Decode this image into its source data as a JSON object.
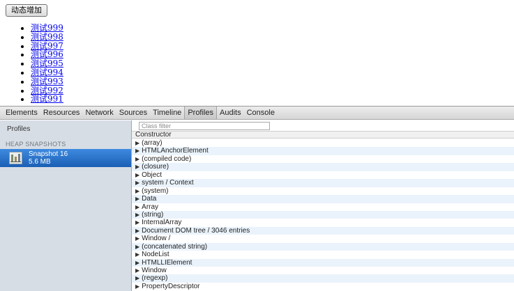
{
  "page": {
    "button_label": "动态增加",
    "links": [
      "测试999",
      "测试998",
      "测试997",
      "测试996",
      "测试995",
      "测试994",
      "测试993",
      "测试992",
      "测试991"
    ]
  },
  "devtools": {
    "tabs": [
      "Elements",
      "Resources",
      "Network",
      "Sources",
      "Timeline",
      "Profiles",
      "Audits",
      "Console"
    ],
    "active_tab": "Profiles",
    "sidebar": {
      "title": "Profiles",
      "section": "HEAP SNAPSHOTS",
      "snapshot_name": "Snapshot 16",
      "snapshot_size": "5.6 MB"
    },
    "filter_placeholder": "Class filter",
    "column_header": "Constructor",
    "constructors": [
      "(array)",
      "HTMLAnchorElement",
      "(compiled code)",
      "(closure)",
      "Object",
      "system / Context",
      "(system)",
      "Data",
      "Array",
      "(string)",
      "InternalArray",
      "Document DOM tree / 3046 entries",
      "Window /",
      "(concatenated string)",
      "NodeList",
      "HTMLLIElement",
      "Window",
      "(regexp)",
      "PropertyDescriptor"
    ],
    "colors": {
      "selection": "#1a5fb4",
      "sidebar_bg": "#d7dde5",
      "row_alt": "#eaf3fb"
    }
  }
}
